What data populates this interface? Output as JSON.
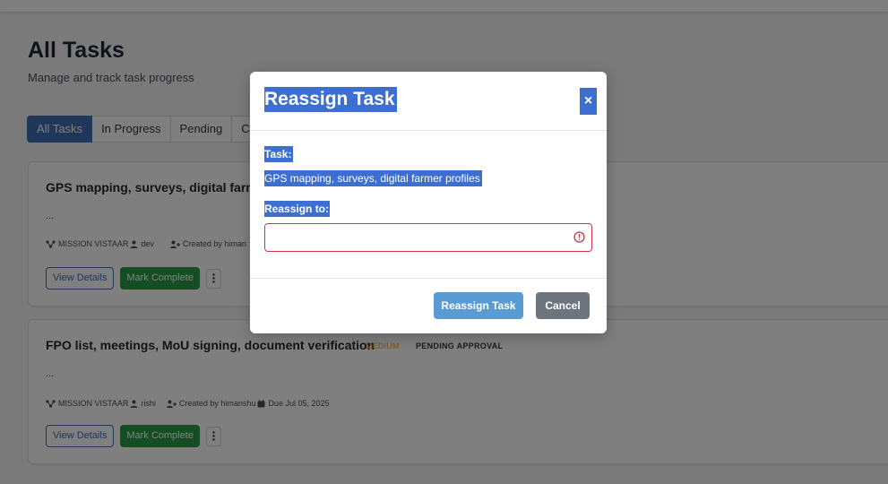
{
  "page": {
    "title": "All Tasks",
    "subtitle": "Manage and track task progress"
  },
  "tabs": [
    {
      "label": "All Tasks",
      "active": true
    },
    {
      "label": "In Progress",
      "active": false
    },
    {
      "label": "Pending",
      "active": false
    },
    {
      "label": "Co",
      "active": false
    }
  ],
  "tasks": [
    {
      "title": "GPS mapping, surveys, digital farme",
      "description": "...",
      "project": "MISSION VISTAAR",
      "assignee": "dev",
      "created_by": "Created by himan",
      "view_label": "View Details",
      "complete_label": "Mark Complete"
    },
    {
      "title": "FPO list, meetings, MoU signing, document verification",
      "priority": "MEDIUM",
      "status": "PENDING APPROVAL",
      "description": "...",
      "project": "MISSION VISTAAR",
      "assignee": "rishi",
      "created_by": "Created by himanshu",
      "due": "Due Jul 05, 2025",
      "view_label": "View Details",
      "complete_label": "Mark Complete"
    }
  ],
  "modal": {
    "title": "Reassign Task",
    "close_symbol": "×",
    "task_label": "Task:",
    "task_name": "GPS mapping, surveys, digital farmer profiles",
    "reassign_label": "Reassign to:",
    "reassign_value": "",
    "submit_label": "Reassign Task",
    "cancel_label": "Cancel"
  },
  "colors": {
    "primary": "#3d6fb6",
    "success": "#2a9d45",
    "warning": "#f0a020",
    "danger": "#d13545",
    "secondary": "#6c757d",
    "selection": "#3d6fd0"
  },
  "icons": [
    "project-icon",
    "user-icon",
    "user-plus-icon",
    "calendar-icon",
    "kebab-icon",
    "close-icon",
    "error-icon"
  ]
}
